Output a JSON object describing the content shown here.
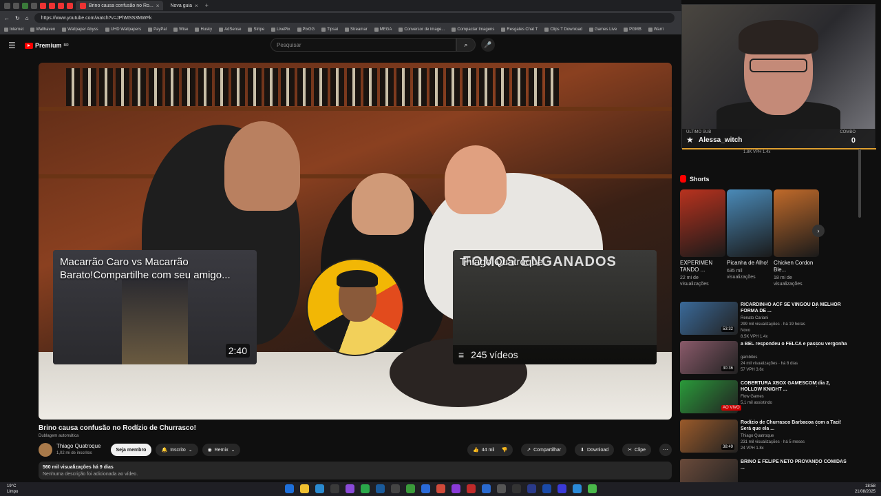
{
  "browser": {
    "tabs": [
      {
        "label": "Brino causa confusão no Ro...",
        "active": true
      },
      {
        "label": "Nova guia",
        "active": false
      }
    ],
    "url": "https://www.youtube.com/watch?v=JPhMSS3MWFk",
    "bookmarks": [
      "Internet",
      "Wallhaven",
      "Wallpaper Abyss",
      "UHD Wallpapers",
      "PayPal",
      "Wise",
      "Husky",
      "AdSense",
      "Stripe",
      "LivePix",
      "PixGG",
      "Tipsai",
      "Streamar",
      "MEGA",
      "Conversor de image...",
      "Compactar Imagens",
      "Resgates Chat T",
      "Clips T Download",
      "Games Live",
      "PGMB",
      "Warri"
    ]
  },
  "youtube": {
    "logo": "Premium",
    "logo_region": "BR",
    "search_placeholder": "Pesquisar"
  },
  "player": {
    "left_card": {
      "title": "Macarrão Caro vs Macarrão Barato!Compartilhe com seu amigo...",
      "duration": "2:40"
    },
    "right_card": {
      "title": "Thiago Quatroque",
      "overlay_text": "FOMOS ENGANADOS",
      "videos": "245 vídeos"
    }
  },
  "video": {
    "title": "Brino causa confusão no Rodízio de Churrasco!",
    "dub": "Dublagem automática",
    "channel": "Thiago Quatroque",
    "subscribers": "1,02 mi de inscritos",
    "member_label": "Seja membro",
    "subscribed_label": "Inscrito",
    "remix_label": "Remix",
    "likes": "44 mil",
    "share_label": "Compartilhar",
    "download_label": "Download",
    "clip_label": "Clipe",
    "views_line": "560 mil visualizações  há 9 dias",
    "description": "Nenhuma descrição foi adicionada ao vídeo."
  },
  "stream_overlay": {
    "last_sub_caption": "ÚLTIMO SUB",
    "last_sub_name": "Alessa_witch",
    "combo_caption": "COMBO",
    "combo_value": "0"
  },
  "sidebar": {
    "top_meta": "1.8K VPH   1.4x",
    "shorts_title": "Shorts",
    "shorts": [
      {
        "title": "EXPERIMEN TANDO ...",
        "views": "22 mi de visualizações",
        "color": "#b8321e"
      },
      {
        "title": "Picanha de Alho!",
        "views": "635 mil visualizações",
        "color": "#4a8ab8"
      },
      {
        "title": "Chicken Cordon Ble...",
        "views": "18 mi de visualizações",
        "color": "#c06a2a"
      }
    ],
    "recs": [
      {
        "title": "RICARDINHO ACF SE VINGOU DA MELHOR FORMA DE ...",
        "channel": "Renato Cariani",
        "views": "299 mil visualizações · há 19 horas",
        "extra": "Novo",
        "stats": "8.5K VPH  1.4x",
        "duration": "53:32",
        "color": "#3a6a9a"
      },
      {
        "title": "a BEL respondeu o FELCA e passou vergonha",
        "channel": "gambitos",
        "views": "24 mil visualizações · há 8 dias",
        "extra": "",
        "stats": "57 VPH  3.6x",
        "duration": "30:36",
        "color": "#8a5a6a"
      },
      {
        "title": "COBERTURA XBOX GAMESCOM dia 2, HOLLOW KNIGHT ...",
        "channel": "Flow Games",
        "views": "5,1 mil assistindo",
        "extra": "",
        "stats": "",
        "duration": "AO VIVO",
        "color": "#2a9a3a"
      },
      {
        "title": "Rodízio de Churrasco Barbacoa com a Taci! Será que ela ...",
        "channel": "Thiago Quatroque",
        "views": "231 mil visualizações · há 5 meses",
        "extra": "",
        "stats": "24 VPH  1.8x",
        "duration": "38:49",
        "color": "#9a5a2a"
      },
      {
        "title": "BRINO E FELIPE NETO PROVANDO COMIDAS ...",
        "channel": "",
        "views": "",
        "extra": "",
        "stats": "",
        "duration": "",
        "color": "#6a4a3a"
      }
    ]
  },
  "taskbar": {
    "temp": "19°C",
    "weather": "Limpo",
    "time": "18:58",
    "date": "21/08/2025"
  }
}
